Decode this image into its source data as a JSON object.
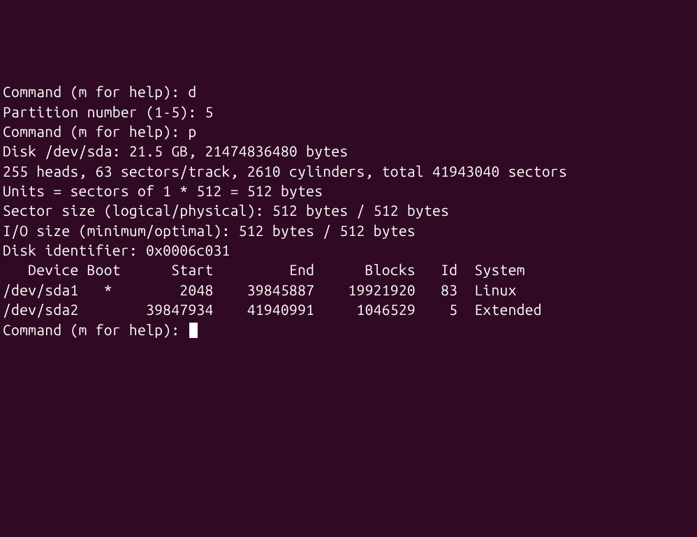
{
  "lines": {
    "cmd1_prompt": "Command (m for help): ",
    "cmd1_input": "d",
    "partition_prompt": "Partition number (1-5): ",
    "partition_input": "5",
    "blank1": "",
    "cmd2_prompt": "Command (m for help): ",
    "cmd2_input": "p",
    "blank2": "",
    "disk_info": "Disk /dev/sda: 21.5 GB, 21474836480 bytes",
    "geometry": "255 heads, 63 sectors/track, 2610 cylinders, total 41943040 sectors",
    "units": "Units = sectors of 1 * 512 = 512 bytes",
    "sector_size": "Sector size (logical/physical): 512 bytes / 512 bytes",
    "io_size": "I/O size (minimum/optimal): 512 bytes / 512 bytes",
    "disk_id": "Disk identifier: 0x0006c031",
    "blank3": "",
    "table_header": "   Device Boot      Start         End      Blocks   Id  System",
    "row1": "/dev/sda1   *        2048    39845887    19921920   83  Linux",
    "row2": "/dev/sda2        39847934    41940991     1046529    5  Extended",
    "blank4": "",
    "cmd3_prompt": "Command (m for help): "
  },
  "partition_table": {
    "columns": [
      "Device",
      "Boot",
      "Start",
      "End",
      "Blocks",
      "Id",
      "System"
    ],
    "rows": [
      {
        "device": "/dev/sda1",
        "boot": "*",
        "start": 2048,
        "end": 39845887,
        "blocks": 19921920,
        "id": "83",
        "system": "Linux"
      },
      {
        "device": "/dev/sda2",
        "boot": "",
        "start": 39847934,
        "end": 41940991,
        "blocks": 1046529,
        "id": "5",
        "system": "Extended"
      }
    ]
  },
  "disk": {
    "path": "/dev/sda",
    "size_human": "21.5 GB",
    "size_bytes": 21474836480,
    "heads": 255,
    "sectors_per_track": 63,
    "cylinders": 2610,
    "total_sectors": 41943040,
    "sector_bytes": 512,
    "identifier": "0x0006c031"
  }
}
